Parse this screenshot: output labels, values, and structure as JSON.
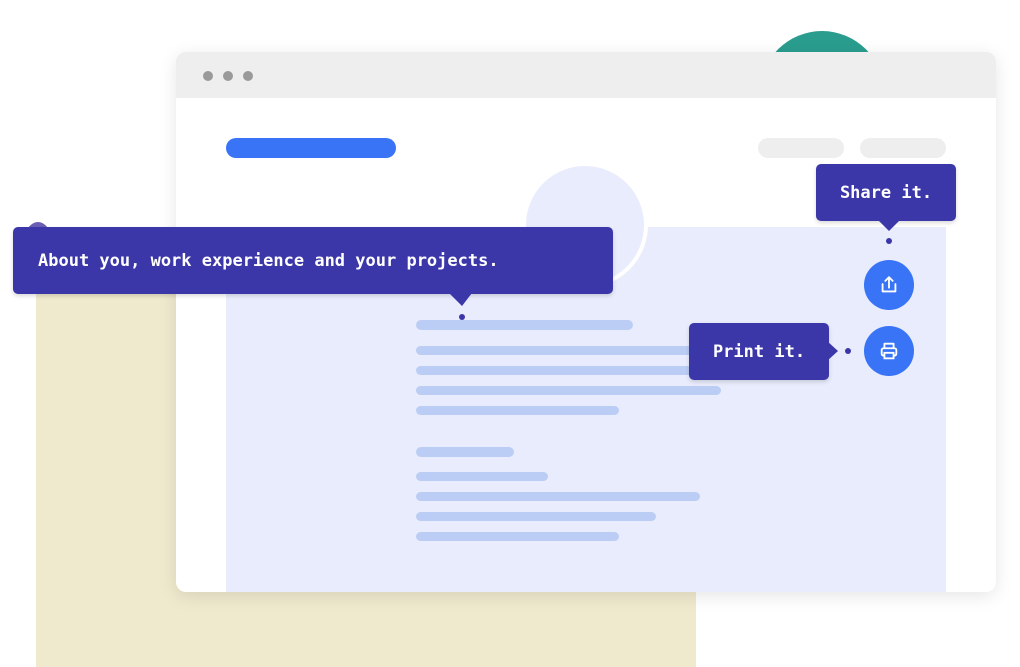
{
  "tooltips": {
    "about": "About you, work experience and your projects.",
    "share": "Share it.",
    "print": "Print it."
  },
  "icons": {
    "share": "share-icon",
    "print": "printer-icon"
  },
  "colors": {
    "accent": "#3874f5",
    "tooltip": "#3b37a8",
    "document": "#e9ecfc",
    "placeholder_line": "#bccdf5",
    "teal": "#2a9d8f",
    "beige": "#efe9cd"
  }
}
